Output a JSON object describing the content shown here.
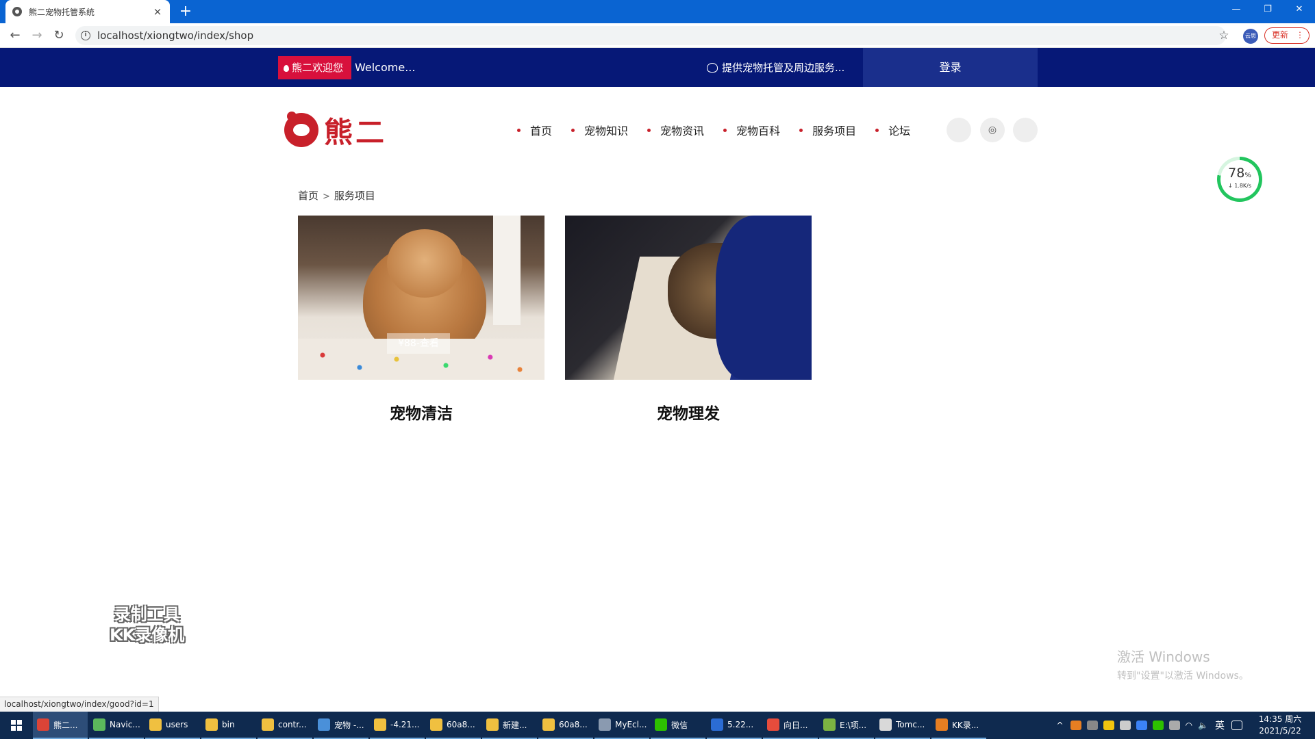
{
  "browser": {
    "tab_title": "熊二宠物托管系统",
    "tab_close": "×",
    "new_tab": "+",
    "url": "localhost/xiongtwo/index/shop",
    "profile_label": "云思",
    "update_label": "更新",
    "status_url": "localhost/xiongtwo/index/good?id=1"
  },
  "topbar": {
    "badge": "熊二欢迎您",
    "welcome": "Welcome...",
    "service": "提供宠物托管及周边服务...",
    "login": "登录",
    "colors": {
      "bar": "#061877",
      "badge": "#d8103c",
      "login_bg": "#1a2f8c"
    }
  },
  "header": {
    "logo_text": "熊二",
    "nav": [
      "首页",
      "宠物知识",
      "宠物资讯",
      "宠物百科",
      "服务项目",
      "论坛"
    ],
    "social_icons": [
      "circle-icon",
      "instagram-icon",
      "circle-icon"
    ],
    "accent": "#c8202a"
  },
  "breadcrumb": {
    "home": "首页",
    "sep": ">",
    "current": "服务项目"
  },
  "services": [
    {
      "name": "宠物清洁",
      "price_tag": "¥88-查看",
      "image": "puppy-photo"
    },
    {
      "name": "宠物理发",
      "image": "grooming-photo"
    }
  ],
  "netmeter": {
    "percent": "78",
    "percent_unit": "%",
    "speed": "↓ 1.8K/s"
  },
  "watermark": {
    "line1": "录制工具",
    "line2": "KK录像机"
  },
  "windows_activation": {
    "line1": "激活 Windows",
    "line2": "转到\"设置\"以激活 Windows。"
  },
  "taskbar": {
    "items": [
      {
        "label": "熊二...",
        "color": "#db4437",
        "active": true
      },
      {
        "label": "Navic...",
        "color": "#5cb85c"
      },
      {
        "label": "users",
        "color": "#f0c040"
      },
      {
        "label": "bin",
        "color": "#f0c040"
      },
      {
        "label": "contr...",
        "color": "#f0c040"
      },
      {
        "label": "宠物 -...",
        "color": "#4a90d9"
      },
      {
        "label": "-4.21...",
        "color": "#f0c040"
      },
      {
        "label": "60a8...",
        "color": "#f0c040"
      },
      {
        "label": "新建...",
        "color": "#f0c040"
      },
      {
        "label": "60a8...",
        "color": "#f0c040"
      },
      {
        "label": "MyEcl...",
        "color": "#8a9ab0"
      },
      {
        "label": "微信",
        "color": "#2dc100"
      },
      {
        "label": "5.22...",
        "color": "#2b6cd4"
      },
      {
        "label": "向日...",
        "color": "#e74c3c"
      },
      {
        "label": "E:\\项...",
        "color": "#7cb342"
      },
      {
        "label": "Tomc...",
        "color": "#d9d9d9"
      },
      {
        "label": "KK录...",
        "color": "#e67e22"
      }
    ],
    "ime": "英",
    "time": "14:35 周六",
    "date": "2021/5/22"
  }
}
